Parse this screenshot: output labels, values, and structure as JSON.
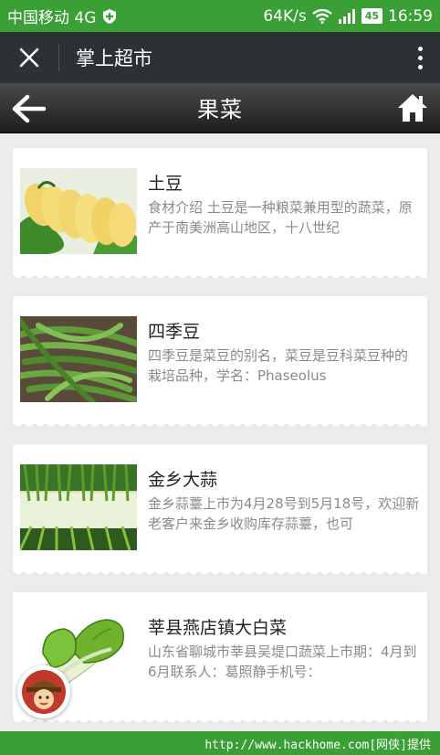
{
  "status_bar": {
    "carrier": "中国移动 4G",
    "speed": "64K/s",
    "battery": "45",
    "time": "16:59"
  },
  "wechat_bar": {
    "title": "掌上超市"
  },
  "page_header": {
    "title": "果菜"
  },
  "items": [
    {
      "title": "土豆",
      "description": "食材介绍 土豆是一种粮菜兼用型的蔬菜，原产于南美洲高山地区，十八世纪",
      "image": "potato-slices"
    },
    {
      "title": "四季豆",
      "description": "四季豆是菜豆的别名，菜豆是豆科菜豆种的栽培品种，学名：Phaseolus",
      "image": "green-beans"
    },
    {
      "title": "金乡大蒜",
      "description": "金乡蒜薹上市为4月28号到5月18号，欢迎新老客户来金乡收购库存蒜薹，也可",
      "image": "green-garlic"
    },
    {
      "title": "莘县燕店镇大白菜",
      "description": "山东省聊城市莘县吴堤口蔬菜上市期：4月到6月联系人：葛照静手机号：",
      "image": "chinese-cabbage"
    }
  ],
  "watermark": "http://www.hackhome.com[网侠]提供",
  "colors": {
    "status_green": "#3a9f35",
    "wechat_bar": "#2d3034",
    "header_dark": "#2a2a2a",
    "list_bg": "#ececec"
  }
}
